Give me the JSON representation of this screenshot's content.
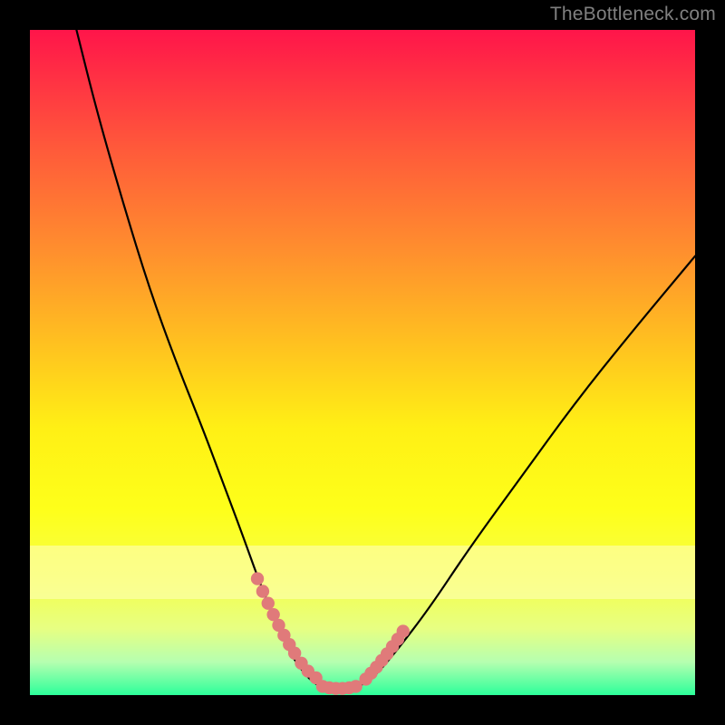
{
  "watermark": "TheBottleneck.com",
  "chart_data": {
    "type": "line",
    "title": "",
    "xlabel": "",
    "ylabel": "",
    "xlim": [
      0,
      100
    ],
    "ylim": [
      0,
      100
    ],
    "series": [
      {
        "name": "bottleneck-curve",
        "x": [
          7,
          10,
          14,
          18,
          22,
          26,
          29,
          32,
          34.5,
          37,
          39,
          41,
          43,
          45,
          48,
          50,
          52,
          55,
          60,
          66,
          74,
          82,
          90,
          100
        ],
        "values": [
          100,
          88,
          74,
          61,
          50,
          40,
          32,
          24,
          17,
          11,
          6.5,
          3.5,
          1.5,
          1,
          1,
          1.5,
          3,
          6.5,
          13,
          22,
          33,
          44,
          54,
          66
        ]
      }
    ],
    "marker_segments": [
      {
        "name": "left-marker-cluster",
        "x": [
          34.2,
          35.0,
          35.8,
          36.6,
          37.4,
          38.2,
          39.0,
          39.8,
          40.8,
          41.8,
          43.0
        ],
        "values": [
          17.5,
          15.6,
          13.8,
          12.1,
          10.5,
          9.0,
          7.6,
          6.3,
          4.8,
          3.6,
          2.6
        ]
      },
      {
        "name": "right-marker-cluster",
        "x": [
          50.5,
          51.3,
          52.1,
          52.9,
          53.7,
          54.5,
          55.3,
          56.1
        ],
        "values": [
          2.4,
          3.3,
          4.2,
          5.2,
          6.2,
          7.3,
          8.4,
          9.6
        ]
      },
      {
        "name": "valley-floor-cluster",
        "x": [
          44.0,
          45.0,
          46.0,
          47.0,
          48.0,
          49.0
        ],
        "values": [
          1.3,
          1.1,
          1.0,
          1.0,
          1.1,
          1.3
        ]
      }
    ],
    "colors": {
      "curve_stroke": "#000000",
      "marker_fill": "#e07a7a",
      "gradient_top": "#ff154a",
      "gradient_bottom": "#2cff9a"
    }
  }
}
